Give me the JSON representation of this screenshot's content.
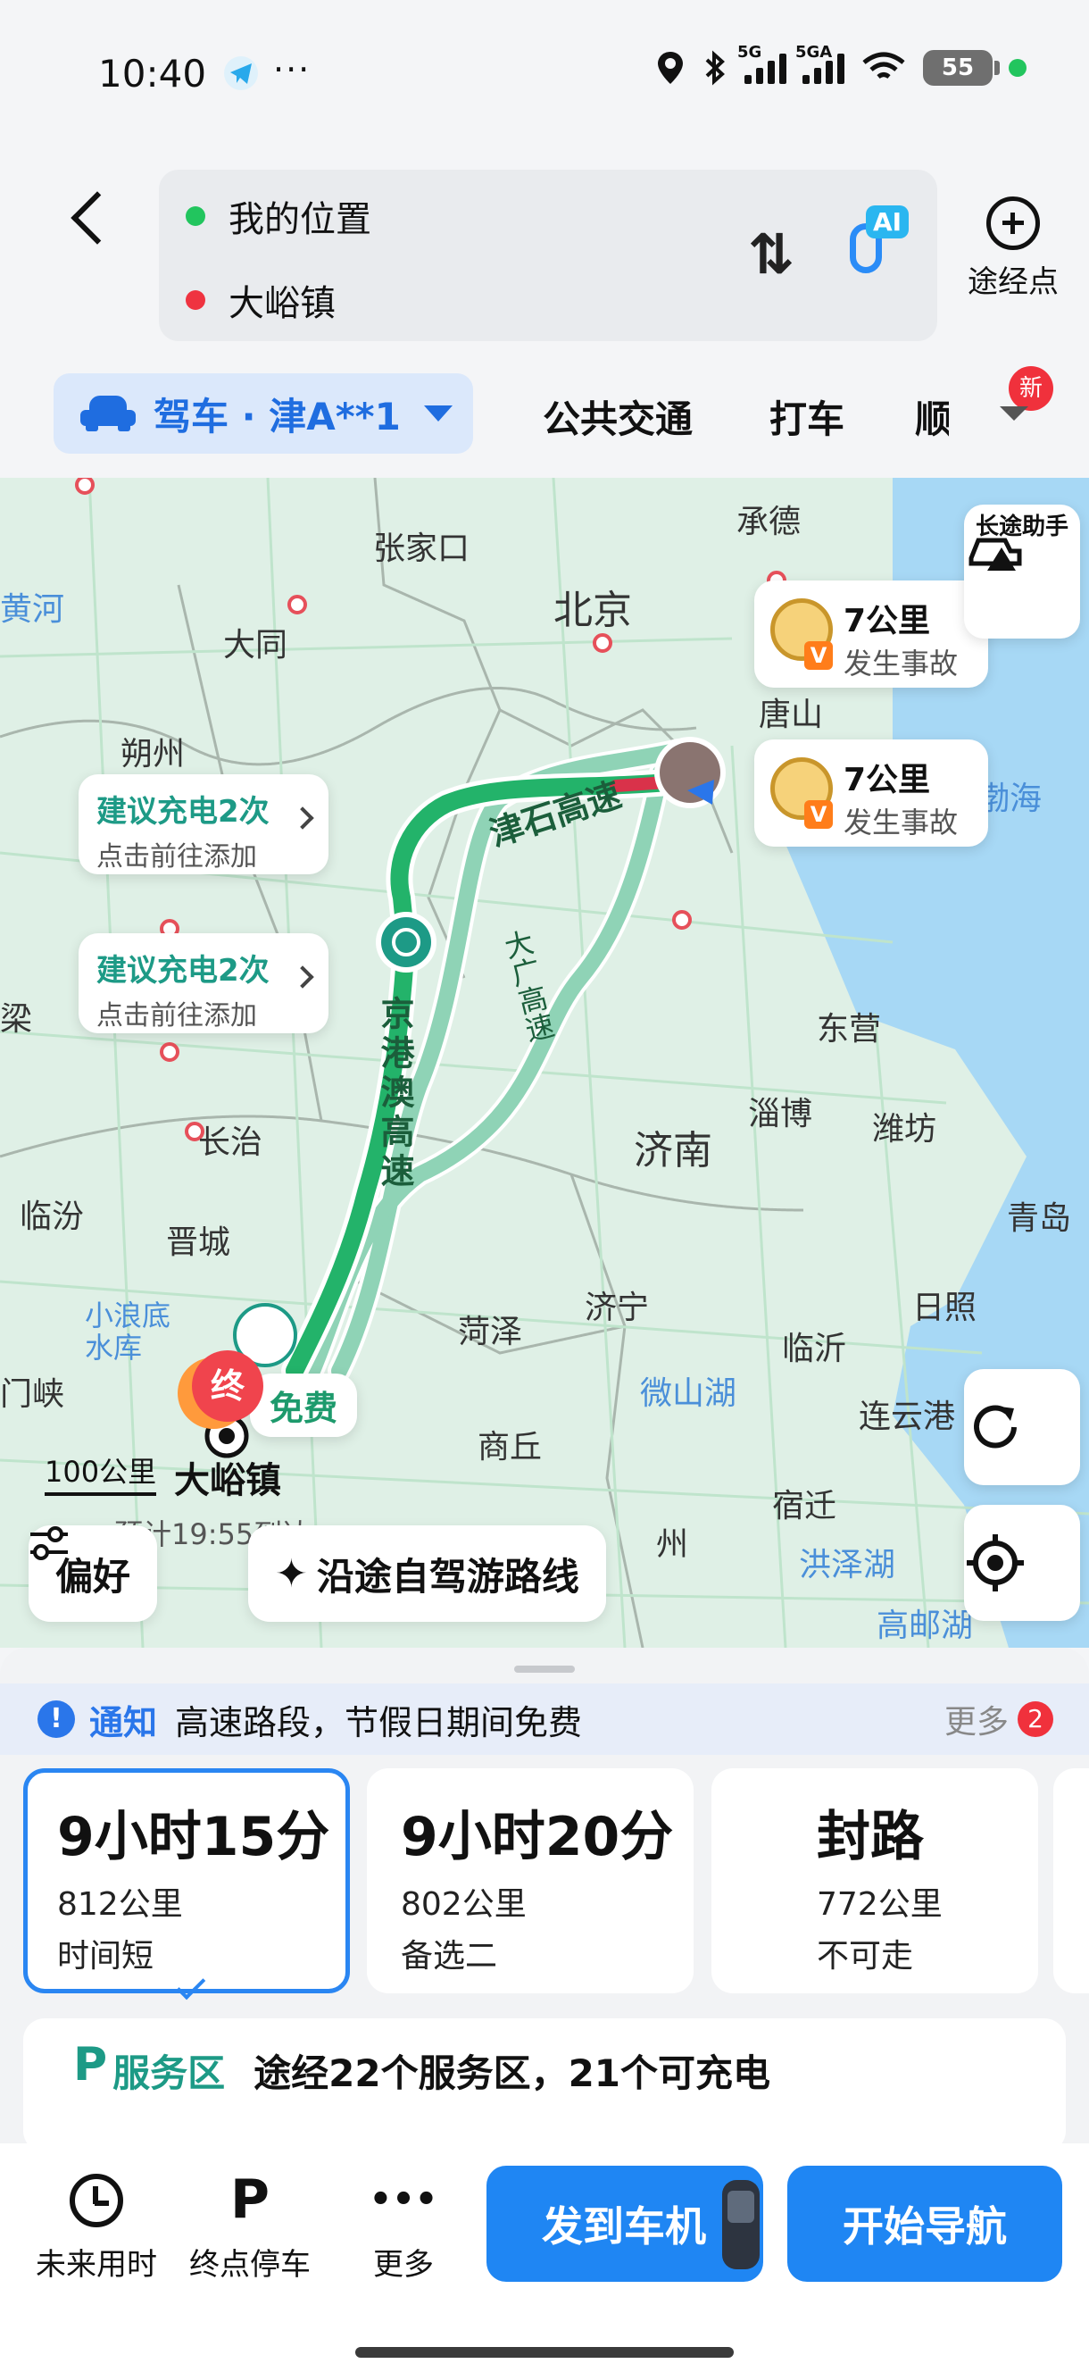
{
  "status_bar": {
    "time": "10:40",
    "more": "···",
    "signal_1": "5G",
    "signal_2": "5GA",
    "battery": "55"
  },
  "header": {
    "origin": "我的位置",
    "destination": "大峪镇",
    "ai_badge": "AI",
    "waypoint_label": "途经点"
  },
  "mode_tabs": {
    "active": "驾车 · 津A**1",
    "items": [
      "公共交通",
      "打车",
      "顺"
    ],
    "new_badge": "新"
  },
  "map": {
    "cities": [
      {
        "name": "张家口"
      },
      {
        "name": "承德"
      },
      {
        "name": "北京"
      },
      {
        "name": "大同"
      },
      {
        "name": "朔州"
      },
      {
        "name": "唐山"
      },
      {
        "name": "东营"
      },
      {
        "name": "淄博"
      },
      {
        "name": "潍坊"
      },
      {
        "name": "济南"
      },
      {
        "name": "长治"
      },
      {
        "name": "临汾"
      },
      {
        "name": "晋城"
      },
      {
        "name": "青岛"
      },
      {
        "name": "济宁"
      },
      {
        "name": "日照"
      },
      {
        "name": "菏泽"
      },
      {
        "name": "临沂"
      },
      {
        "name": "连云港"
      },
      {
        "name": "商丘"
      },
      {
        "name": "宿迁"
      },
      {
        "name": "黄河"
      },
      {
        "name": "渤海"
      },
      {
        "name": "梁"
      },
      {
        "name": "门峡"
      },
      {
        "name": "微山湖"
      },
      {
        "name": "洪泽湖"
      },
      {
        "name": "高邮湖"
      },
      {
        "name": "小浪底水库"
      },
      {
        "name": "州"
      }
    ],
    "roads": {
      "r1": "津石高速",
      "r2": "京港澳高速",
      "r3": "大广高速"
    },
    "charge_cards": [
      {
        "title": "建议充电2次",
        "subtitle": "点击前往添加"
      },
      {
        "title": "建议充电2次",
        "subtitle": "点击前往添加"
      }
    ],
    "accidents": [
      {
        "distance": "7公里",
        "desc": "发生事故",
        "v": "V"
      },
      {
        "distance": "7公里",
        "desc": "发生事故",
        "v": "V"
      }
    ],
    "long_trip_helper": "长途助手",
    "free_tag": "免费",
    "end_marker": "终",
    "destination_label": "大峪镇",
    "scale": "100公里",
    "eta_partial": "预计19:55到达",
    "chips": {
      "preference": "偏好",
      "scenic": "沿途自驾游路线"
    },
    "colors": {
      "route_primary": "#23b36a",
      "route_alt": "#8fd3b6",
      "sea": "#a7d8f5"
    }
  },
  "sheet": {
    "notice": {
      "label": "通知",
      "text": "高速路段，节假日期间免费",
      "more": "更多",
      "count": "2"
    },
    "routes": [
      {
        "duration": "9小时15分",
        "distance": "812公里",
        "tag": "时间短",
        "selected": true
      },
      {
        "duration": "9小时20分",
        "distance": "802公里",
        "tag": "备选二",
        "selected": false
      },
      {
        "duration": "封路",
        "distance": "772公里",
        "tag": "不可走",
        "selected": false
      }
    ],
    "service": {
      "icon": "P",
      "label": "服务区",
      "text": "途经22个服务区，21个可充电"
    }
  },
  "actions": {
    "future_time": "未来用时",
    "parking": "终点停车",
    "parking_icon": "P",
    "more": "更多",
    "more_icon": "•••",
    "send_to_car": "发到车机",
    "start_nav": "开始导航"
  }
}
